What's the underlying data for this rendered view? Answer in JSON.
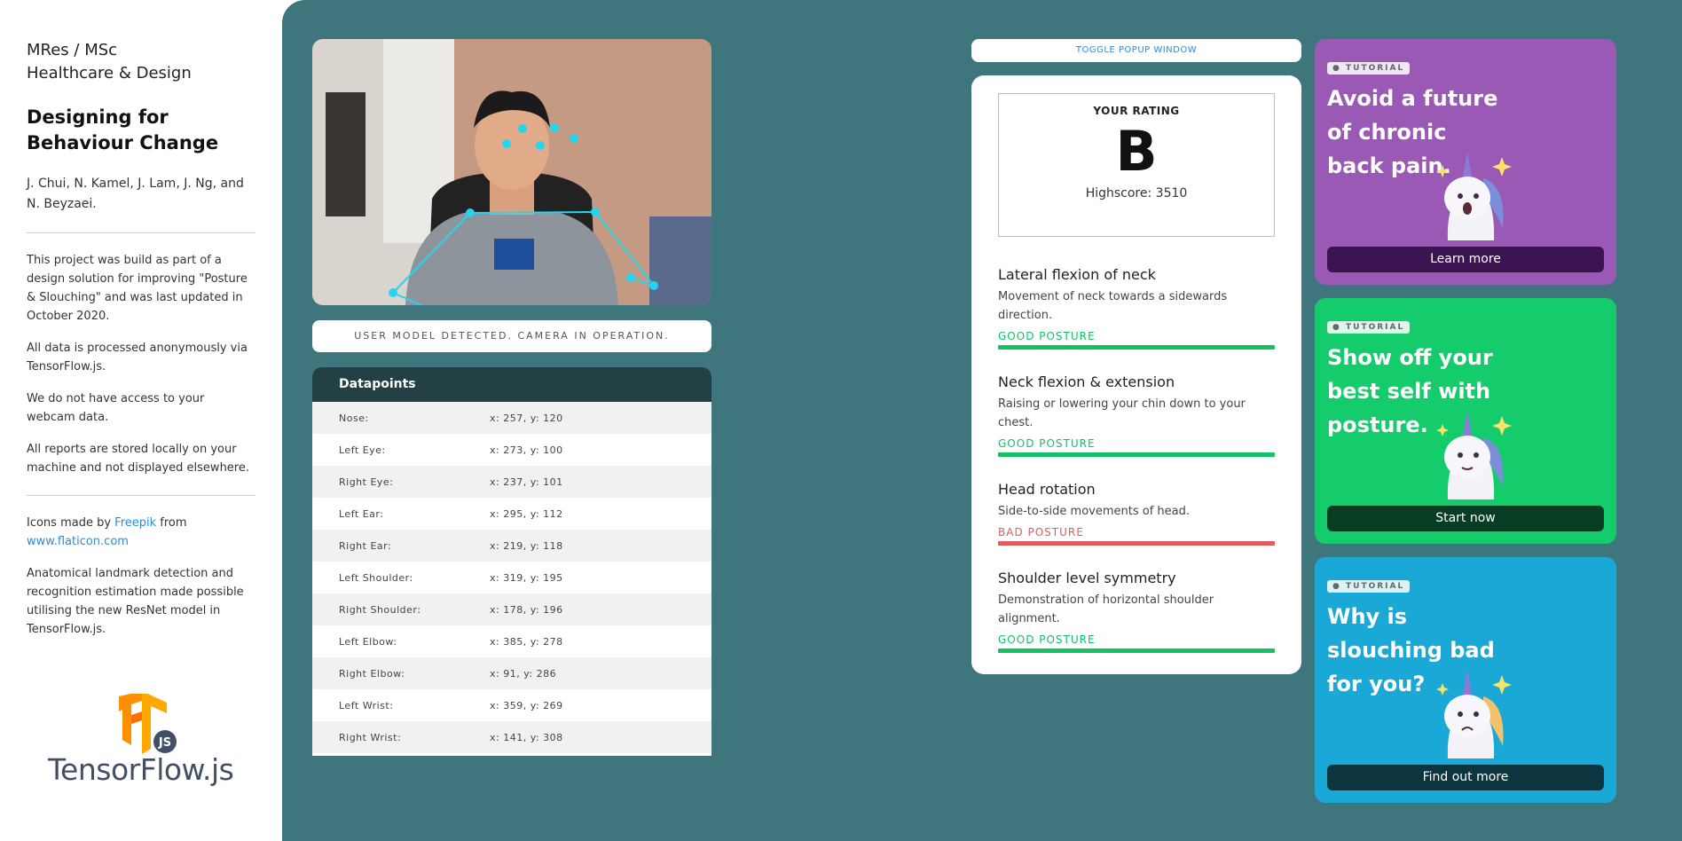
{
  "sidebar": {
    "program_line1": "MRes / MSc",
    "program_line2": "Healthcare & Design",
    "title_line1": "Designing for",
    "title_line2": "Behaviour Change",
    "authors": "J. Chui, N. Kamel, J. Lam, J. Ng, and N. Beyzaei.",
    "para1": "This project was build as part of a design solution for improving \"Posture & Slouching\" and was last updated in October 2020.",
    "para2": "All data is processed anonymously via TensorFlow.js.",
    "para3": "We do not have access to your webcam data.",
    "para4": "All reports are stored locally on your machine and not displayed elsewhere.",
    "credit_prefix": "Icons made by ",
    "credit_link1": "Freepik",
    "credit_mid": " from ",
    "credit_link2": "www.flaticon.com",
    "para5": "Anatomical landmark detection and recognition estimation made possible utilising the new ResNet model in TensorFlow.js.",
    "logo_word": "TensorFlow.js",
    "logo_badge": "JS"
  },
  "status_text": "USER MODEL DETECTED. CAMERA IN OPERATION.",
  "datapoints": {
    "title": "Datapoints",
    "rows": [
      {
        "label": "Nose:",
        "value": "x: 257, y: 120"
      },
      {
        "label": "Left Eye:",
        "value": "x: 273, y: 100"
      },
      {
        "label": "Right Eye:",
        "value": "x: 237, y: 101"
      },
      {
        "label": "Left Ear:",
        "value": "x: 295, y: 112"
      },
      {
        "label": "Right Ear:",
        "value": "x: 219, y: 118"
      },
      {
        "label": "Left Shoulder:",
        "value": "x: 319, y: 195"
      },
      {
        "label": "Right Shoulder:",
        "value": "x: 178, y: 196"
      },
      {
        "label": "Left Elbow:",
        "value": "x: 385, y: 278"
      },
      {
        "label": "Right Elbow:",
        "value": "x: 91, y: 286"
      },
      {
        "label": "Left Wrist:",
        "value": "x: 359, y: 269"
      },
      {
        "label": "Right Wrist:",
        "value": "x: 141, y: 308"
      }
    ]
  },
  "toggle_label": "TOGGLE POPUP WINDOW",
  "rating": {
    "label": "YOUR RATING",
    "grade": "B",
    "highscore": "Highscore: 3510"
  },
  "metrics": [
    {
      "title": "Lateral flexion of neck",
      "desc": "Movement of neck towards a sidewards direction.",
      "status": "GOOD POSTURE",
      "good": true
    },
    {
      "title": "Neck flexion & extension",
      "desc": "Raising or lowering your chin down to your chest.",
      "status": "GOOD POSTURE",
      "good": true
    },
    {
      "title": "Head rotation",
      "desc": "Side-to-side movements of head.",
      "status": "BAD POSTURE",
      "good": false
    },
    {
      "title": "Shoulder level symmetry",
      "desc": "Demonstration of horizontal shoulder alignment.",
      "status": "GOOD POSTURE",
      "good": true
    }
  ],
  "tutorials": [
    {
      "badge": "TUTORIAL",
      "title": "Avoid a future of chronic back pain.",
      "button": "Learn more",
      "bg": "#9b59b6",
      "btn_bg": "#3c1452",
      "icon": "unicorn-shocked-icon"
    },
    {
      "badge": "TUTORIAL",
      "title": "Show off your best self with posture.",
      "button": "Start now",
      "bg": "#14cc6c",
      "btn_bg": "#073d22",
      "icon": "unicorn-fancy-icon"
    },
    {
      "badge": "TUTORIAL",
      "title": "Why is slouching bad for you?",
      "button": "Find out more",
      "bg": "#1aa8d6",
      "btn_bg": "#0c3540",
      "icon": "unicorn-sad-icon"
    }
  ],
  "colors": {
    "panel_bg": "#3f767d",
    "good": "#14c165",
    "bad": "#e05c5c",
    "keypoint": "#27d4ef"
  }
}
